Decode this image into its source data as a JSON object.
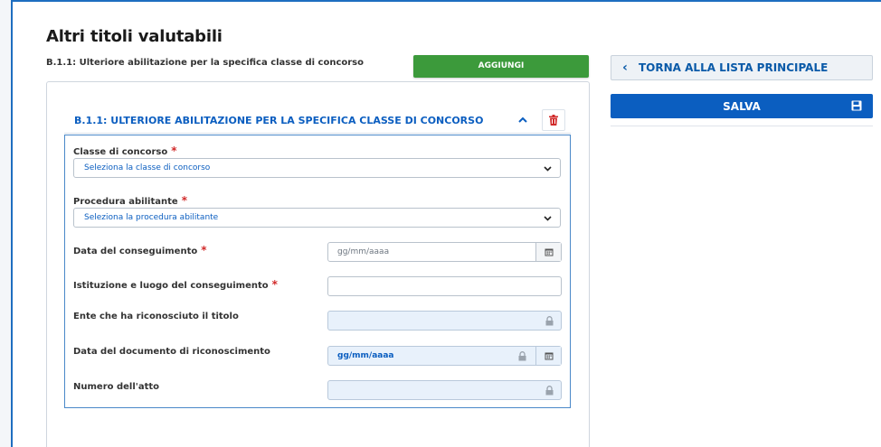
{
  "page": {
    "title": "Altri titoli valutabili",
    "subtitle": "B.1.1: Ulteriore abilitazione per la specifica classe di concorso",
    "add_button": "AGGIUNGI"
  },
  "sidebar": {
    "back_button": "TORNA ALLA LISTA PRINCIPALE",
    "save_button": "SALVA"
  },
  "accordion": {
    "title": "B.1.1: ULTERIORE ABILITAZIONE PER LA SPECIFICA CLASSE DI CONCORSO"
  },
  "form": {
    "classe": {
      "label": "Classe di concorso",
      "required_mark": "*",
      "value": "Seleziona la classe di concorso"
    },
    "procedura": {
      "label": "Procedura abilitante",
      "required_mark": "*",
      "value": "Seleziona la procedura abilitante"
    },
    "data_conseguimento": {
      "label": "Data del conseguimento",
      "required_mark": "*",
      "placeholder": "gg/mm/aaaa"
    },
    "istituzione": {
      "label": "Istituzione e luogo del conseguimento",
      "required_mark": "*",
      "value": ""
    },
    "ente": {
      "label": "Ente che ha riconosciuto il titolo",
      "value": ""
    },
    "data_documento": {
      "label": "Data del documento di riconoscimento",
      "value": "gg/mm/aaaa"
    },
    "numero_atto": {
      "label": "Numero dell'atto",
      "value": ""
    }
  },
  "colors": {
    "primary": "#0b5ec0",
    "success": "#3c9a3b",
    "danger": "#d12a2a",
    "readonly_bg": "#e8f1fb"
  }
}
